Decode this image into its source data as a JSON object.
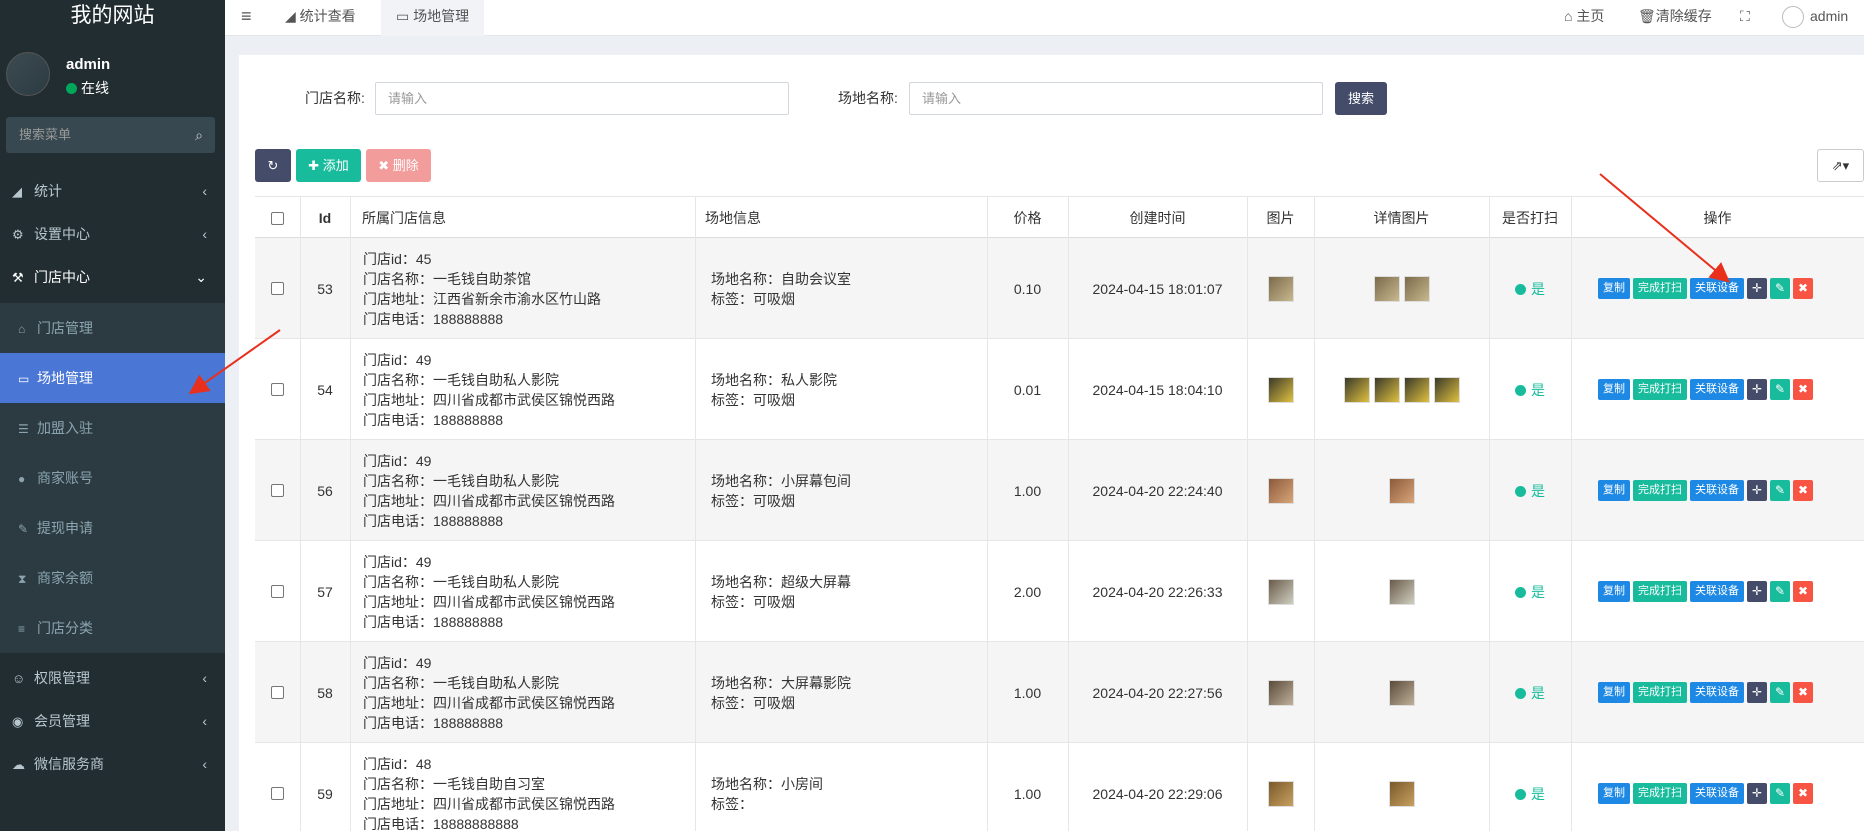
{
  "site": {
    "title": "我的网站"
  },
  "user": {
    "name": "admin",
    "status": "在线"
  },
  "sidebar": {
    "search_placeholder": "搜索菜单",
    "items": [
      {
        "label": "统计",
        "icon": "area-chart-icon"
      },
      {
        "label": "设置中心",
        "icon": "cogs-icon"
      },
      {
        "label": "门店中心",
        "icon": "tools-icon"
      }
    ],
    "sub_items": [
      {
        "label": "门店管理",
        "icon": "home-icon"
      },
      {
        "label": "场地管理",
        "icon": "laptop-icon"
      },
      {
        "label": "加盟入驻",
        "icon": "list-icon"
      },
      {
        "label": "商家账号",
        "icon": "user-icon"
      },
      {
        "label": "提现申请",
        "icon": "edit-icon"
      },
      {
        "label": "商家余额",
        "icon": "hourglass-icon"
      },
      {
        "label": "门店分类",
        "icon": "list-ol-icon"
      }
    ],
    "bottom_items": [
      {
        "label": "权限管理",
        "icon": "users-icon"
      },
      {
        "label": "会员管理",
        "icon": "user-circle-icon"
      },
      {
        "label": "微信服务商",
        "icon": "wechat-icon"
      }
    ]
  },
  "topbar": {
    "tabs": [
      {
        "label": "统计查看"
      },
      {
        "label": "场地管理"
      }
    ],
    "home": "主页",
    "clear_cache": "清除缓存",
    "admin": "admin"
  },
  "filters": {
    "store_label": "门店名称:",
    "store_placeholder": "请输入",
    "venue_label": "场地名称:",
    "venue_placeholder": "请输入",
    "search_button": "搜索"
  },
  "toolbar": {
    "add": "添加",
    "delete": "删除"
  },
  "table": {
    "headers": {
      "id": "Id",
      "store": "所属门店信息",
      "venue": "场地信息",
      "price": "价格",
      "created": "创建时间",
      "image": "图片",
      "detail_images": "详情图片",
      "cleaned": "是否打扫",
      "ops": "操作"
    },
    "ops_labels": {
      "copy": "复制",
      "done": "完成打扫",
      "link": "关联设备"
    },
    "rows": [
      {
        "id": "53",
        "store_id": "门店id：45",
        "store_name": "门店名称：一毛钱自助茶馆",
        "store_addr": "门店地址：江西省新余市渝水区竹山路",
        "store_phone": "门店电话：188888888",
        "venue_name": "场地名称：自助会议室",
        "venue_tag": "标签：可吸烟",
        "price": "0.10",
        "created": "2024-04-15 18:01:07",
        "detail_count": 2,
        "cleaned": "是"
      },
      {
        "id": "54",
        "store_id": "门店id：49",
        "store_name": "门店名称：一毛钱自助私人影院",
        "store_addr": "门店地址：四川省成都市武侯区锦悦西路",
        "store_phone": "门店电话：188888888",
        "venue_name": "场地名称：私人影院",
        "venue_tag": "标签：可吸烟",
        "price": "0.01",
        "created": "2024-04-15 18:04:10",
        "detail_count": 4,
        "cleaned": "是"
      },
      {
        "id": "56",
        "store_id": "门店id：49",
        "store_name": "门店名称：一毛钱自助私人影院",
        "store_addr": "门店地址：四川省成都市武侯区锦悦西路",
        "store_phone": "门店电话：188888888",
        "venue_name": "场地名称：小屏幕包间",
        "venue_tag": "标签：可吸烟",
        "price": "1.00",
        "created": "2024-04-20 22:24:40",
        "detail_count": 1,
        "cleaned": "是"
      },
      {
        "id": "57",
        "store_id": "门店id：49",
        "store_name": "门店名称：一毛钱自助私人影院",
        "store_addr": "门店地址：四川省成都市武侯区锦悦西路",
        "store_phone": "门店电话：188888888",
        "venue_name": "场地名称：超级大屏幕",
        "venue_tag": "标签：可吸烟",
        "price": "2.00",
        "created": "2024-04-20 22:26:33",
        "detail_count": 1,
        "cleaned": "是"
      },
      {
        "id": "58",
        "store_id": "门店id：49",
        "store_name": "门店名称：一毛钱自助私人影院",
        "store_addr": "门店地址：四川省成都市武侯区锦悦西路",
        "store_phone": "门店电话：188888888",
        "venue_name": "场地名称：大屏幕影院",
        "venue_tag": "标签：可吸烟",
        "price": "1.00",
        "created": "2024-04-20 22:27:56",
        "detail_count": 1,
        "cleaned": "是"
      },
      {
        "id": "59",
        "store_id": "门店id：48",
        "store_name": "门店名称：一毛钱自助自习室",
        "store_addr": "门店地址：四川省成都市武侯区锦悦西路",
        "store_phone": "门店电话：18888888888",
        "venue_name": "场地名称：小房间",
        "venue_tag": "标签：",
        "price": "1.00",
        "created": "2024-04-20 22:29:06",
        "detail_count": 1,
        "cleaned": "是"
      }
    ]
  },
  "colors": {
    "sidebar_bg": "#222d32",
    "active": "#4a76d6",
    "success": "#18bc9c",
    "primary": "#1e88e5",
    "danger": "#f75444",
    "dark": "#444c69",
    "arrow": "#e8301c"
  }
}
